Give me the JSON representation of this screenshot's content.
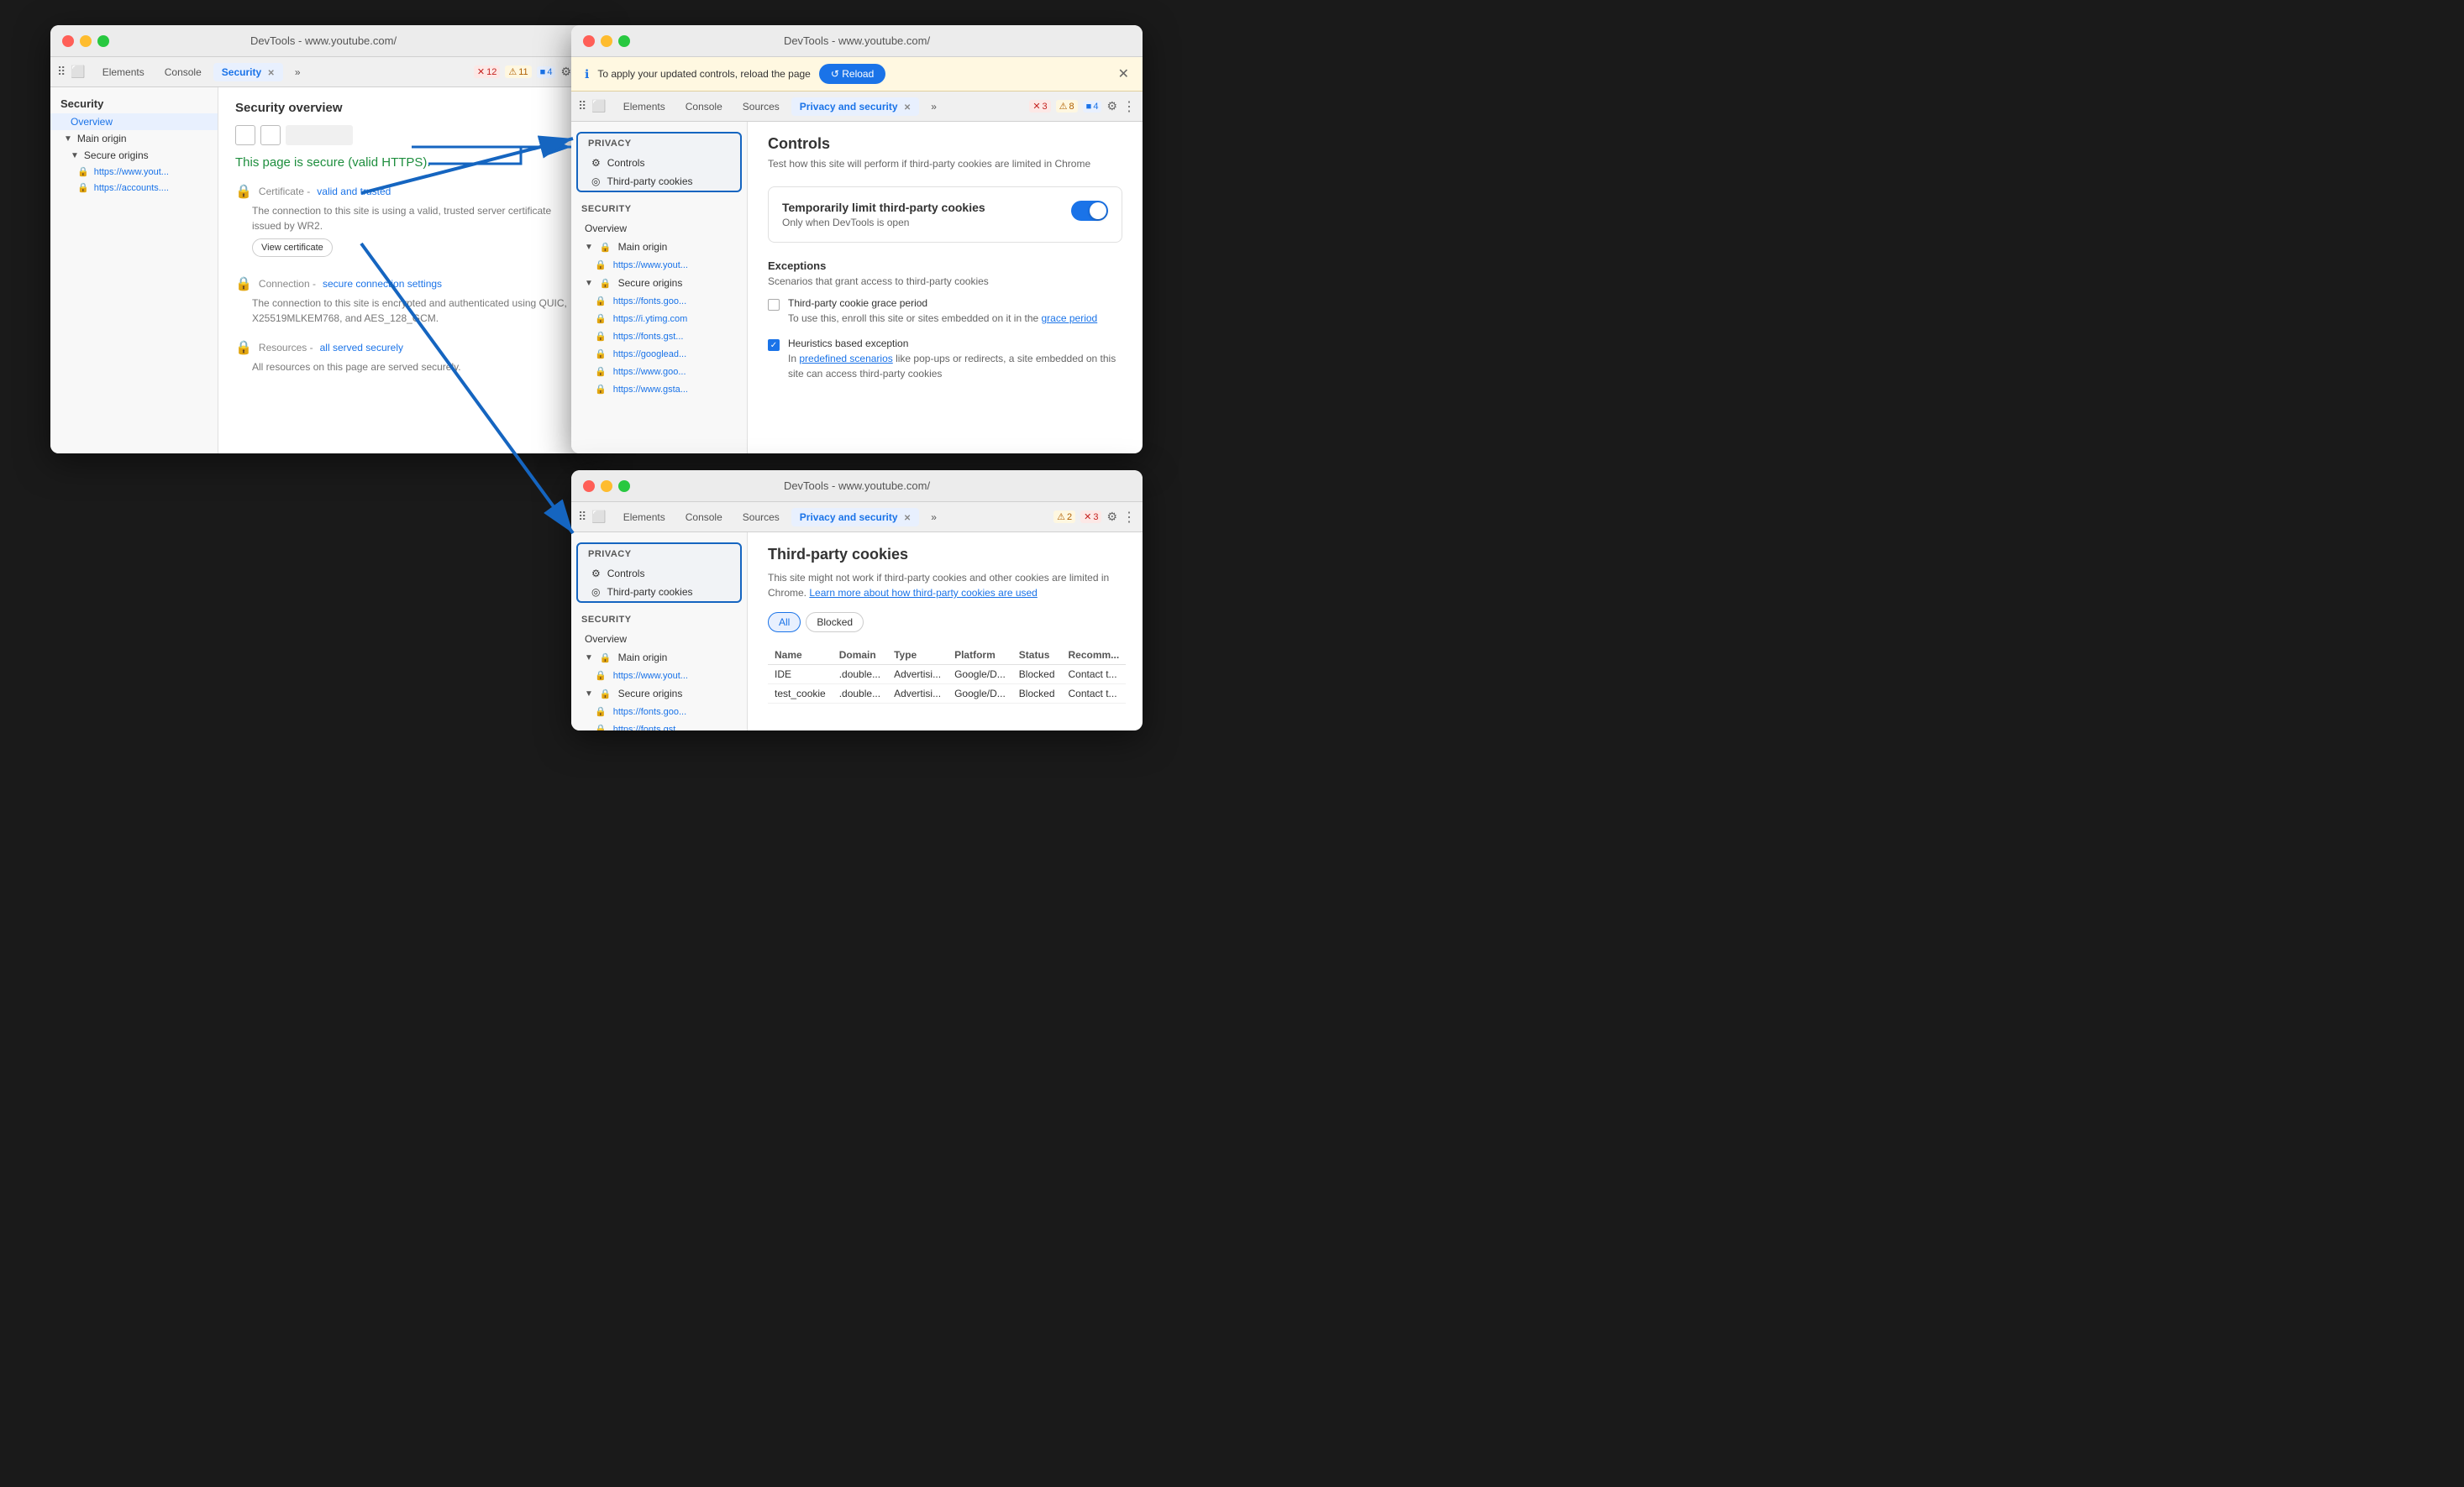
{
  "windows": {
    "left": {
      "title": "DevTools - www.youtube.com/",
      "tabs": [
        "Elements",
        "Console",
        "Security",
        "»"
      ],
      "activeTab": "Security",
      "badges": [
        {
          "type": "error",
          "icon": "✕",
          "count": "12"
        },
        {
          "type": "warning",
          "icon": "⚠",
          "count": "11"
        },
        {
          "type": "info",
          "icon": "■",
          "count": "4"
        }
      ],
      "sidebar": {
        "header": "Security",
        "items": [
          {
            "label": "Overview",
            "indent": 1,
            "active": false
          },
          {
            "label": "Main origin",
            "indent": 0,
            "triangle": true
          },
          {
            "label": "Secure origins",
            "indent": 0,
            "triangle": true
          },
          {
            "label": "https://www.yout...",
            "indent": 2,
            "lock": true
          },
          {
            "label": "https://accounts....",
            "indent": 2,
            "lock": true
          }
        ]
      },
      "main": {
        "title": "Security overview",
        "secure_message": "This page is secure (valid HTTPS).",
        "details": [
          {
            "icon": "🔒",
            "label": "Certificate",
            "status": "valid and trusted",
            "text": "The connection to this site is using a valid, trusted server certificate issued by WR2.",
            "button": "View certificate"
          },
          {
            "icon": "🔒",
            "label": "Connection",
            "status": "secure connection settings",
            "text": "The connection to this site is encrypted and authenticated using QUIC, X25519MLKEM768, and AES_128_GCM."
          },
          {
            "icon": "🔒",
            "label": "Resources",
            "status": "all served securely",
            "text": "All resources on this page are served securely."
          }
        ]
      }
    },
    "topRight": {
      "title": "DevTools - www.youtube.com/",
      "notification": "To apply your updated controls, reload the page",
      "reload_label": "↺ Reload",
      "tabs": [
        "Elements",
        "Console",
        "Sources",
        "Privacy and security",
        "»"
      ],
      "activeTab": "Privacy and security",
      "badges": [
        {
          "type": "error",
          "icon": "✕",
          "count": "3"
        },
        {
          "type": "warning",
          "icon": "⚠",
          "count": "8"
        },
        {
          "type": "info",
          "icon": "■",
          "count": "4"
        }
      ],
      "privacySidebar": {
        "privacy_header": "Privacy",
        "privacy_items": [
          {
            "label": "Controls",
            "icon": "⚙"
          },
          {
            "label": "Third-party cookies",
            "icon": "◎"
          }
        ],
        "security_header": "Security",
        "security_items": [
          {
            "label": "Overview",
            "lock": false
          },
          {
            "label": "Main origin",
            "lock": true,
            "triangle": true
          },
          {
            "label": "https://www.yout...",
            "lock": true,
            "indent": true
          },
          {
            "label": "Secure origins",
            "lock": true,
            "triangle": true
          },
          {
            "label": "https://fonts.goo...",
            "lock": true,
            "indent": true
          },
          {
            "label": "https://i.ytimg.com",
            "lock": true,
            "indent": true
          },
          {
            "label": "https://fonts.gst...",
            "lock": true,
            "indent": true
          },
          {
            "label": "https://googlead...",
            "lock": true,
            "indent": true
          },
          {
            "label": "https://www.goo...",
            "lock": true,
            "indent": true
          },
          {
            "label": "https://www.gsta...",
            "lock": true,
            "indent": true
          }
        ]
      },
      "controls": {
        "title": "Controls",
        "subtitle": "Test how this site will perform if third-party cookies are limited in Chrome",
        "cookie_limit": {
          "title": "Temporarily limit third-party cookies",
          "subtitle": "Only when DevTools is open",
          "enabled": true
        },
        "exceptions_title": "Exceptions",
        "exceptions_sub": "Scenarios that grant access to third-party cookies",
        "exceptions": [
          {
            "label": "Third-party cookie grace period",
            "text": "To use this, enroll this site or sites embedded on it in the grace period",
            "link": "grace period",
            "checked": false
          },
          {
            "label": "Heuristics based exception",
            "text": "In predefined scenarios like pop-ups or redirects, a site embedded on this site can access third-party cookies",
            "link": "predefined scenarios",
            "checked": true
          }
        ]
      }
    },
    "bottomRight": {
      "title": "DevTools - www.youtube.com/",
      "tabs": [
        "Elements",
        "Console",
        "Sources",
        "Privacy and security",
        "»"
      ],
      "activeTab": "Privacy and security",
      "badges": [
        {
          "type": "warning",
          "icon": "⚠",
          "count": "2"
        },
        {
          "type": "error",
          "icon": "✕",
          "count": "3"
        }
      ],
      "privacySidebar": {
        "privacy_header": "Privacy",
        "privacy_items": [
          {
            "label": "Controls",
            "icon": "⚙"
          },
          {
            "label": "Third-party cookies",
            "icon": "◎"
          }
        ],
        "security_header": "Security",
        "security_items": [
          {
            "label": "Overview",
            "lock": false
          },
          {
            "label": "Main origin",
            "lock": true,
            "triangle": true
          },
          {
            "label": "https://www.yout...",
            "lock": true,
            "indent": true
          },
          {
            "label": "Secure origins",
            "lock": true,
            "triangle": true
          },
          {
            "label": "https://fonts.goo...",
            "lock": true,
            "indent": true
          },
          {
            "label": "https://fonts.gst...",
            "lock": true,
            "indent": true
          }
        ]
      },
      "tpc": {
        "title": "Third-party cookies",
        "subtitle": "This site might not work if third-party cookies and other cookies are limited in Chrome.",
        "link_text": "Learn more about how third-party cookies are used",
        "filters": [
          "All",
          "Blocked"
        ],
        "active_filter": "All",
        "table_headers": [
          "Name",
          "Domain",
          "Type",
          "Platform",
          "Status",
          "Recomm..."
        ],
        "rows": [
          [
            "IDE",
            ".double...",
            "Advertisi...",
            "Google/D...",
            "Blocked",
            "Contact t..."
          ],
          [
            "test_cookie",
            ".double...",
            "Advertisi...",
            "Google/D...",
            "Blocked",
            "Contact t..."
          ]
        ]
      }
    }
  }
}
